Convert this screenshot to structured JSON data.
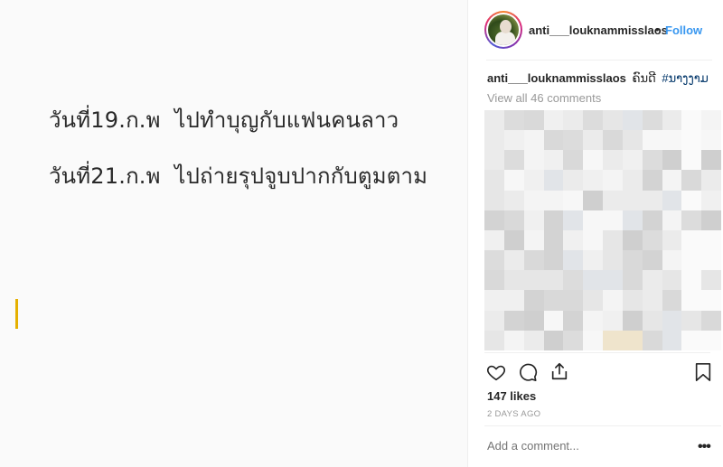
{
  "post_media": {
    "line1": "วันที่19.ก.พ  ไปทำบุญกับแฟนคนลาว",
    "line2": "วันที่21.ก.พ  ไปถ่ายรุปจูบปากกับตูมตาม"
  },
  "header": {
    "username": "anti___louknammisslaos",
    "separator": "•",
    "follow_label": "Follow"
  },
  "caption": {
    "username": "anti___louknammisslaos",
    "text": "ຄົນດີ",
    "hashtag": "#ນາງງາມ"
  },
  "comments": {
    "view_all_label": "View all 46 comments"
  },
  "actions": {
    "like_icon": "heart-icon",
    "comment_icon": "speech-bubble-icon",
    "share_icon": "share-icon",
    "save_icon": "bookmark-icon"
  },
  "stats": {
    "likes_label": "147 likes",
    "time_ago": "2 DAYS AGO"
  },
  "comment_box": {
    "placeholder": "Add a comment...",
    "more_label": "•••"
  },
  "colors": {
    "link_blue": "#3897f0",
    "hashtag_blue": "#003569",
    "cursor_yellow": "#e5b000"
  }
}
